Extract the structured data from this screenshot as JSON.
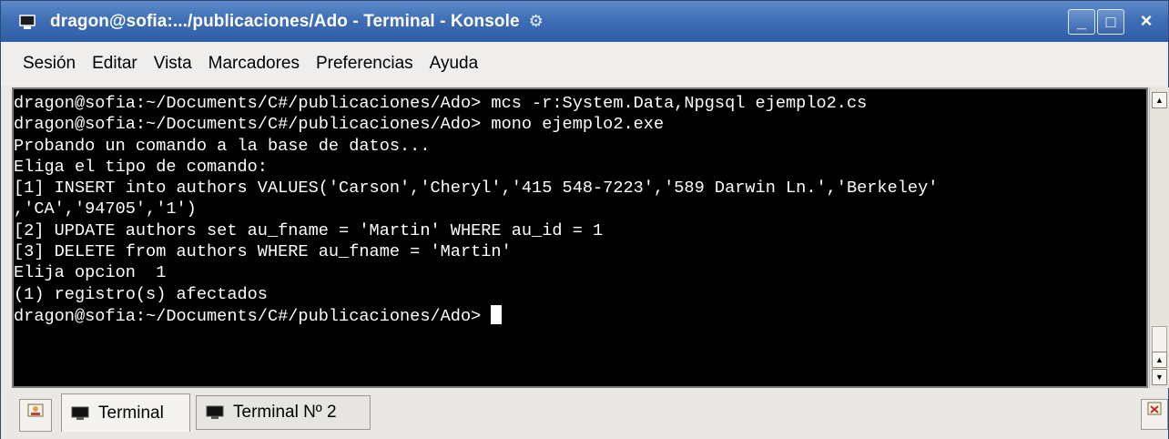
{
  "window": {
    "title": "dragon@sofia:.../publicaciones/Ado - Terminal - Konsole",
    "minimize_label": "_",
    "maximize_label": "□",
    "close_label": "×"
  },
  "menu": [
    {
      "label": "Sesión"
    },
    {
      "label": "Editar"
    },
    {
      "label": "Vista"
    },
    {
      "label": "Marcadores"
    },
    {
      "label": "Preferencias"
    },
    {
      "label": "Ayuda"
    }
  ],
  "terminal": {
    "lines": [
      "dragon@sofia:~/Documents/C#/publicaciones/Ado> mcs -r:System.Data,Npgsql ejemplo2.cs",
      "dragon@sofia:~/Documents/C#/publicaciones/Ado> mono ejemplo2.exe",
      "Probando un comando a la base de datos...",
      "Eliga el tipo de comando:",
      "[1] INSERT into authors VALUES('Carson','Cheryl','415 548-7223','589 Darwin Ln.','Berkeley'",
      ",'CA','94705','1')",
      "[2] UPDATE authors set au_fname = 'Martin' WHERE au_id = 1",
      "[3] DELETE from authors WHERE au_fname = 'Martin'",
      "Elija opcion  1",
      "(1) registro(s) afectados",
      "dragon@sofia:~/Documents/C#/publicaciones/Ado> "
    ]
  },
  "tabs": [
    {
      "label": "Terminal",
      "active": true
    },
    {
      "label": "Terminal Nº 2",
      "active": false
    }
  ],
  "colors": {
    "titlebar": "#3f6fb6",
    "terminal_bg": "#000000",
    "terminal_fg": "#ffffff"
  },
  "icons": {
    "app": "konsole-terminal-icon",
    "title_extra": "gear-icon",
    "new_session": "new-session-icon",
    "close_session": "close-session-icon",
    "tab": "terminal-tab-icon"
  }
}
